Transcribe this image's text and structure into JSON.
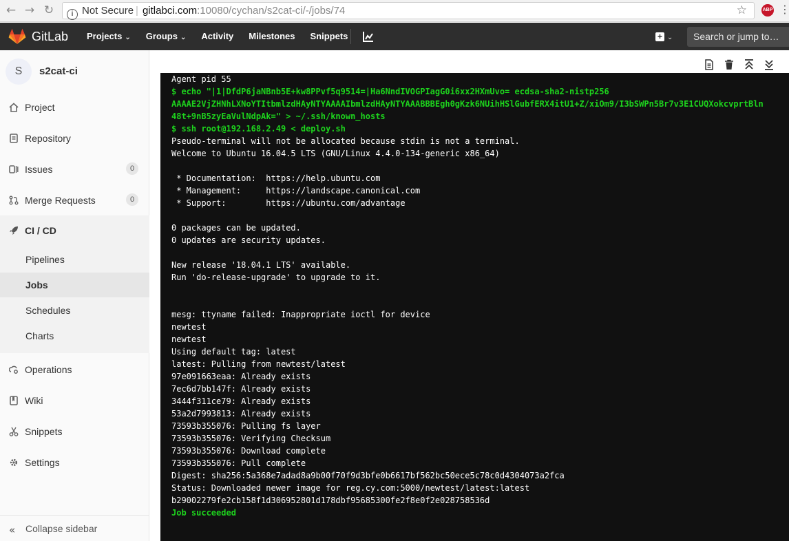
{
  "browser": {
    "security": "Not Secure",
    "host": "gitlabci.com",
    "path": ":10080/cychan/s2cat-ci/-/jobs/74",
    "abp": "ABP"
  },
  "header": {
    "brand": "GitLab",
    "nav": [
      "Projects",
      "Groups",
      "Activity",
      "Milestones",
      "Snippets"
    ],
    "search_placeholder": "Search or jump to…"
  },
  "sidebar": {
    "avatar_letter": "S",
    "project_name": "s2cat-ci",
    "items": [
      {
        "label": "Project",
        "icon": "home-icon"
      },
      {
        "label": "Repository",
        "icon": "doc-icon"
      },
      {
        "label": "Issues",
        "icon": "issues-icon",
        "count": "0"
      },
      {
        "label": "Merge Requests",
        "icon": "merge-icon",
        "count": "0"
      },
      {
        "label": "CI / CD",
        "icon": "rocket-icon"
      },
      {
        "label": "Operations",
        "icon": "cloud-gear-icon"
      },
      {
        "label": "Wiki",
        "icon": "book-icon"
      },
      {
        "label": "Snippets",
        "icon": "scissors-icon"
      },
      {
        "label": "Settings",
        "icon": "gear-icon"
      }
    ],
    "ci_sub": [
      "Pipelines",
      "Jobs",
      "Schedules",
      "Charts"
    ],
    "collapse": "Collapse sidebar"
  },
  "log": [
    {
      "t": "Agent pid 55",
      "g": false
    },
    {
      "t": "$ echo \"|1|DfdP6jaNBnb5E+kw8PPvf5q9514=|Ha6NndIVOGPIagG0i6xx2HXmUvo= ecdsa-sha2-nistp256",
      "g": true
    },
    {
      "t": "AAAAE2VjZHNhLXNoYTItbmlzdHAyNTYAAAAIbmlzdHAyNTYAAABBBEgh0gKzk6NUihHSlGubfERX4itU1+Z/xiOm9/I3bSWPn5Br7v3E1CUQXokcvprtBln",
      "g": true
    },
    {
      "t": "48t+9nB5zyEaVulNdpAk=\" > ~/.ssh/known_hosts",
      "g": true
    },
    {
      "t": "$ ssh root@192.168.2.49 < deploy.sh",
      "g": true
    },
    {
      "t": "Pseudo-terminal will not be allocated because stdin is not a terminal.",
      "g": false
    },
    {
      "t": "Welcome to Ubuntu 16.04.5 LTS (GNU/Linux 4.4.0-134-generic x86_64)",
      "g": false
    },
    {
      "t": "",
      "g": false
    },
    {
      "t": " * Documentation:  https://help.ubuntu.com",
      "g": false
    },
    {
      "t": " * Management:     https://landscape.canonical.com",
      "g": false
    },
    {
      "t": " * Support:        https://ubuntu.com/advantage",
      "g": false
    },
    {
      "t": "",
      "g": false
    },
    {
      "t": "0 packages can be updated.",
      "g": false
    },
    {
      "t": "0 updates are security updates.",
      "g": false
    },
    {
      "t": "",
      "g": false
    },
    {
      "t": "New release '18.04.1 LTS' available.",
      "g": false
    },
    {
      "t": "Run 'do-release-upgrade' to upgrade to it.",
      "g": false
    },
    {
      "t": "",
      "g": false
    },
    {
      "t": "",
      "g": false
    },
    {
      "t": "mesg: ttyname failed: Inappropriate ioctl for device",
      "g": false
    },
    {
      "t": "newtest",
      "g": false
    },
    {
      "t": "newtest",
      "g": false
    },
    {
      "t": "Using default tag: latest",
      "g": false
    },
    {
      "t": "latest: Pulling from newtest/latest",
      "g": false
    },
    {
      "t": "97e091663eaa: Already exists",
      "g": false
    },
    {
      "t": "7ec6d7bb147f: Already exists",
      "g": false
    },
    {
      "t": "3444f311ce79: Already exists",
      "g": false
    },
    {
      "t": "53a2d7993813: Already exists",
      "g": false
    },
    {
      "t": "73593b355076: Pulling fs layer",
      "g": false
    },
    {
      "t": "73593b355076: Verifying Checksum",
      "g": false
    },
    {
      "t": "73593b355076: Download complete",
      "g": false
    },
    {
      "t": "73593b355076: Pull complete",
      "g": false
    },
    {
      "t": "Digest: sha256:5a368e7adad8a9b00f70f9d3bfe0b6617bf562bc50ece5c78c0d4304073a2fca",
      "g": false
    },
    {
      "t": "Status: Downloaded newer image for reg.cy.com:5000/newtest/latest:latest",
      "g": false
    },
    {
      "t": "b29002279fe2cb158f1d306952801d178dbf95685300fe2f8e0f2e028758536d",
      "g": false
    },
    {
      "t": "Job succeeded",
      "g": true
    }
  ],
  "colors": {
    "terminal_bg": "#111111",
    "terminal_green": "#1dd31d",
    "header_bg": "#2e2e2e"
  }
}
